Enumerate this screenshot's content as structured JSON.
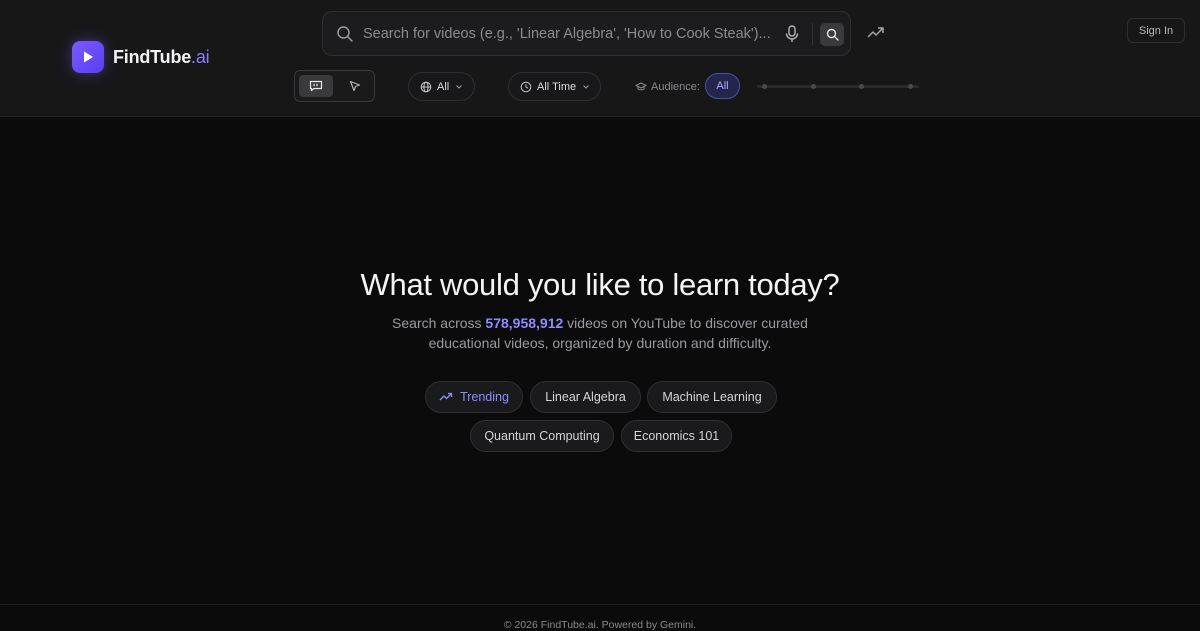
{
  "brand": {
    "name": "FindTube",
    "suffix": ".ai",
    "accent": "#7a5cff",
    "icon": "play-icon"
  },
  "search": {
    "placeholder": "Search for videos (e.g., 'Linear Algebra', 'How to Cook Steak')...",
    "value": "",
    "icons": [
      "search-icon",
      "microphone-icon",
      "search-submit-icon",
      "trending-icon"
    ]
  },
  "header": {
    "sign_in_label": "Sign In"
  },
  "filters": {
    "language": {
      "value": "All",
      "icon": "globe-icon"
    },
    "time": {
      "value": "All Time",
      "icon": "clock-icon"
    },
    "audience": {
      "label": "Audience:",
      "value": "All",
      "icon": "graduation-cap-icon",
      "levels": 4
    }
  },
  "hero": {
    "title": "What would you like to learn today?",
    "subtitle_before": "Search across",
    "video_count": "578,958,912",
    "subtitle_after": "videos on YouTube to discover curated educational videos, organized by duration and difficulty."
  },
  "suggestions": [
    {
      "label": "Trending",
      "highlight": true
    },
    {
      "label": "Linear Algebra"
    },
    {
      "label": "Machine Learning"
    },
    {
      "label": "Quantum Computing"
    },
    {
      "label": "Economics 101"
    }
  ],
  "footer": {
    "text": "© 2026 FindTube.ai. Powered by Gemini."
  },
  "colors": {
    "background": "#0b0b0c",
    "header": "#171718",
    "accent_text": "#8e8cff",
    "audience_selected": "#23264a"
  }
}
